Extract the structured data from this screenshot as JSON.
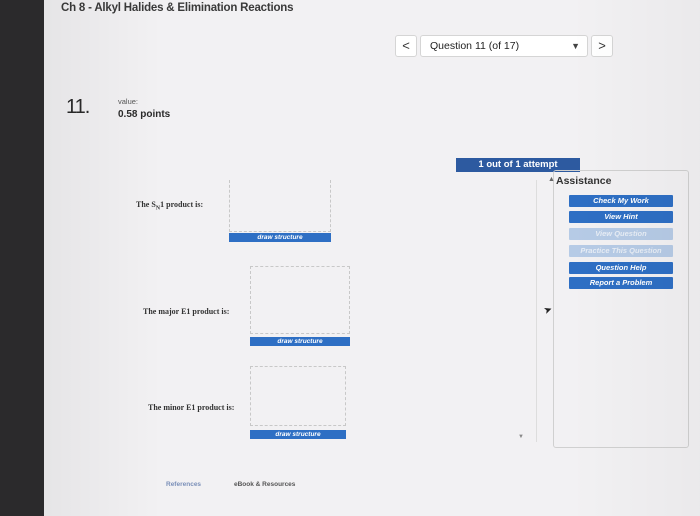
{
  "header": {
    "chapter_title": "Ch 8 - Alkyl Halides & Elimination Reactions"
  },
  "nav": {
    "prev_label": "<",
    "next_label": ">",
    "question_select": "Question 11 (of 17)",
    "caret_icon": "▼"
  },
  "question": {
    "number": "11.",
    "value_label": "value:",
    "points": "0.58 points"
  },
  "attempts": "1 out of 1 attempt",
  "assistance": {
    "title": "Assistance",
    "buttons": [
      {
        "label": "Check My Work",
        "enabled": true
      },
      {
        "label": "View Hint",
        "enabled": true
      },
      {
        "label": "View Question",
        "enabled": false
      },
      {
        "label": "Practice This Question",
        "enabled": false
      },
      {
        "label": "Question Help",
        "enabled": true
      },
      {
        "label": "Report a Problem",
        "enabled": true
      }
    ]
  },
  "answers": [
    {
      "label_prefix": "The S",
      "label_sub": "N",
      "label_suffix": "1 product is:",
      "button": "draw structure"
    },
    {
      "label": "The major E1 product is:",
      "button": "draw structure"
    },
    {
      "label": "The minor E1 product is:",
      "button": "draw structure"
    }
  ],
  "footer": {
    "references": "References",
    "ebook": "eBook & Resources"
  },
  "colors": {
    "accent": "#2e6fc4",
    "attempt_bar": "#2d5aa0",
    "disabled": "#b6cbe6"
  }
}
